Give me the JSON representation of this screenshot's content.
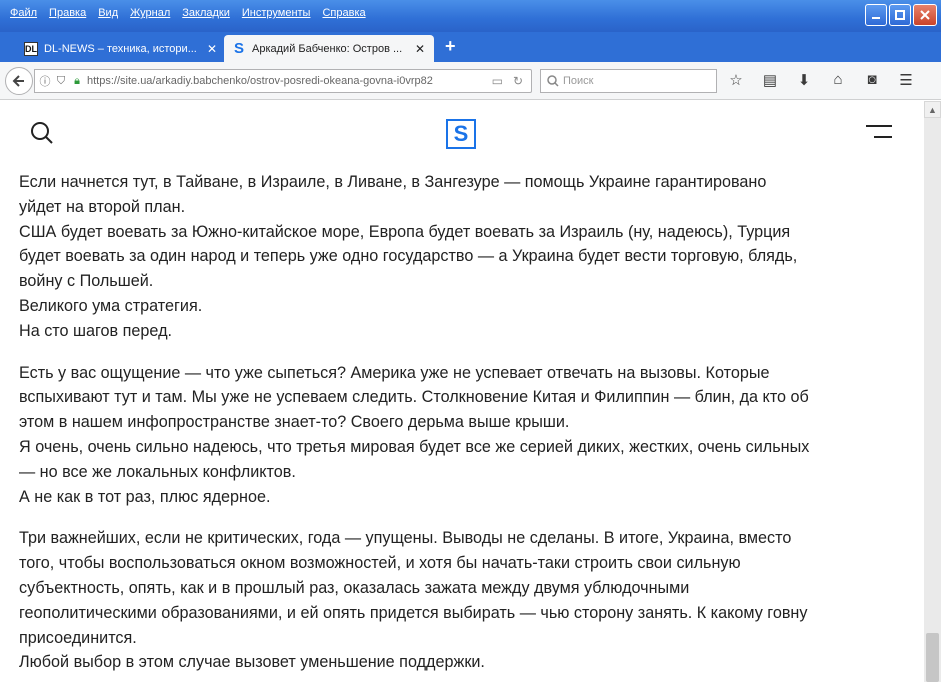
{
  "menu": [
    "Файл",
    "Правка",
    "Вид",
    "Журнал",
    "Закладки",
    "Инструменты",
    "Справка"
  ],
  "tabs": [
    {
      "title": "DL-NEWS – техника, истори...",
      "favicon": "dl-news-favicon"
    },
    {
      "title": "Аркадий Бабченко: Остров ...",
      "favicon": "site-s-favicon"
    }
  ],
  "toolbar": {
    "url": "https://site.ua/arkadiy.babchenko/ostrov-posredi-okeana-govna-i0vrp82",
    "search_placeholder": "Поиск"
  },
  "site": {
    "logo_text": "S"
  },
  "article": {
    "paragraphs": [
      [
        "Если начнется тут, в Тайване, в Израиле, в Ливане, в Зангезуре — помощь Украине гарантировано",
        "уйдет на второй план.",
        "США будет воевать за Южно-китайское море, Европа будет воевать за Израиль (ну, надеюсь), Турция",
        "будет воевать за один народ и теперь уже одно государство — а Украина будет вести торговую, блядь,",
        "войну с Польшей.",
        "Великого ума стратегия.",
        "На сто шагов перед."
      ],
      [
        "Есть у вас ощущение — что уже сыпеться? Америка уже не успевает отвечать на вызовы. Которые",
        "вспыхивают тут и там. Мы уже не успеваем следить. Столкновение Китая и Филиппин — блин, да кто об",
        "этом в нашем инфопространстве знает-то? Своего дерьма выше крыши.",
        "Я очень, очень сильно надеюсь, что третья мировая будет все же серией диких, жестких, очень сильных",
        "— но все же локальных конфликтов.",
        "А не как в тот раз, плюс ядерное."
      ],
      [
        "Три важнейших, если не критических, года — упущены. Выводы не сделаны. В итоге, Украина, вместо",
        "того, чтобы воспользоваться окном возможностей, и хотя бы начать-таки строить свои сильную",
        "субъектность, опять, как и в прошлый раз, оказалась зажата между двумя ублюдочными",
        "геополитическими образованиями, и ей опять придется выбирать — чью сторону занять. К какому говну",
        "присоединится.",
        "Любой выбор в этом случае вызовет уменьшение поддержки."
      ]
    ]
  }
}
